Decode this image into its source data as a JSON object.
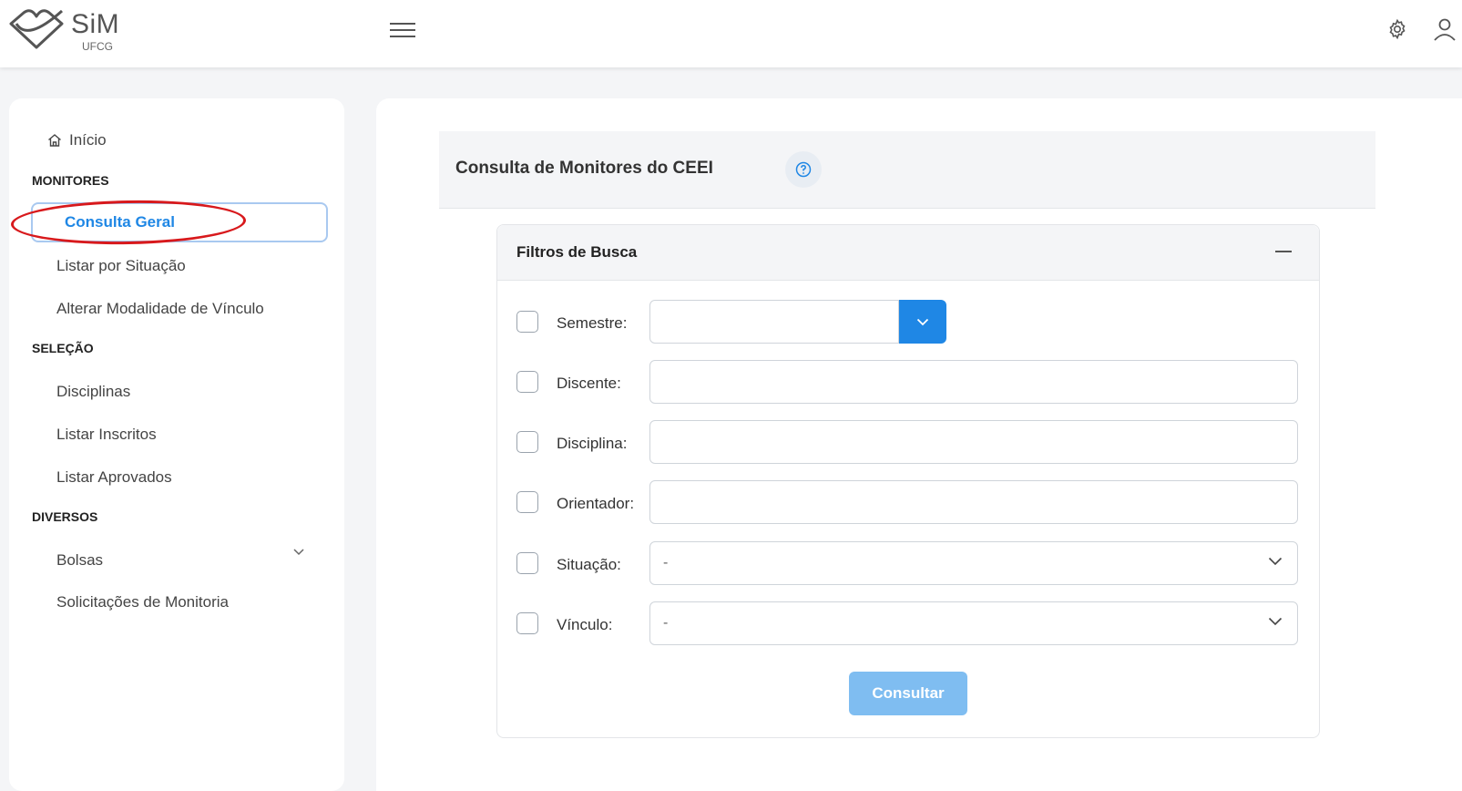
{
  "app": {
    "logo_text": "SiM",
    "logo_sub": "UFCG",
    "icons": {
      "menu": "hamburger-icon",
      "settings": "gear-icon",
      "user": "user-icon"
    }
  },
  "sidebar": {
    "home": "Início",
    "sections": [
      {
        "title": "MONITORES",
        "items": [
          "Consulta Geral",
          "Listar por Situação",
          "Alterar Modalidade de Vínculo"
        ]
      },
      {
        "title": "SELEÇÃO",
        "items": [
          "Disciplinas",
          "Listar Inscritos",
          "Listar Aprovados"
        ]
      },
      {
        "title": "DIVERSOS",
        "items": [
          "Bolsas",
          "Solicitações de Monitoria"
        ]
      }
    ],
    "active_item": "Consulta Geral",
    "accent_color": "#1f87e5",
    "highlight_color": "#d8191c"
  },
  "main": {
    "page_title": "Consulta de Monitores do CEEI",
    "filters": {
      "title": "Filtros de Busca",
      "fields": [
        {
          "label": "Semestre:",
          "type": "select-button",
          "value": ""
        },
        {
          "label": "Discente:",
          "type": "text",
          "value": ""
        },
        {
          "label": "Disciplina:",
          "type": "text",
          "value": ""
        },
        {
          "label": "Orientador:",
          "type": "text",
          "value": ""
        },
        {
          "label": "Situação:",
          "type": "select",
          "value": "-"
        },
        {
          "label": "Vínculo:",
          "type": "select",
          "value": "-"
        }
      ],
      "submit_label": "Consultar"
    }
  }
}
